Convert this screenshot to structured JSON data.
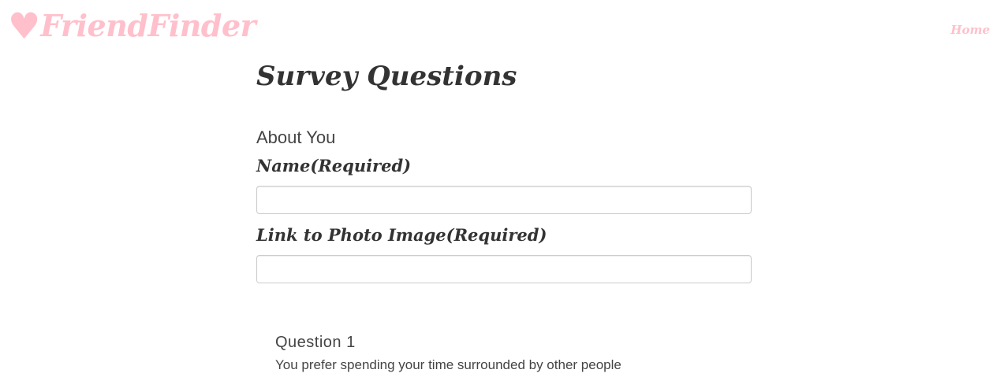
{
  "brand": {
    "heart_glyph": "♥",
    "name": "FriendFinder",
    "color": "#ffc0cb"
  },
  "nav": {
    "home_label": "Home"
  },
  "page": {
    "title": "Survey Questions"
  },
  "about_section": {
    "heading": "About You",
    "name_label": "Name(Required)",
    "name_value": "",
    "photo_label": "Link to Photo Image(Required)",
    "photo_value": ""
  },
  "questions": [
    {
      "title": "Question 1",
      "text": "You prefer spending your time surrounded by other people"
    }
  ]
}
